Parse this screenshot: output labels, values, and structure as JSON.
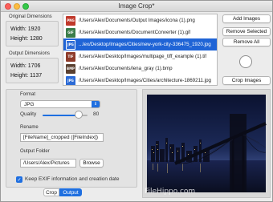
{
  "window": {
    "title": "Image Crop*"
  },
  "original": {
    "label": "Original Dimensions",
    "width": "Width: 1920",
    "height": "Height: 1280"
  },
  "output": {
    "label": "Output Dimensions",
    "width": "Width: 1706",
    "height": "Height: 1137"
  },
  "files": [
    {
      "type": "PNG",
      "color": "#c0392b",
      "name": "/Users/Alex/Documents/Output Images/icona (1).png"
    },
    {
      "type": "GIF",
      "color": "#3b7d4a",
      "name": "/Users/Alex/Documents/DocumentConverter (1).gif"
    },
    {
      "type": "JPG",
      "color": "#2c6bd6",
      "name": "...lex/Desktop/Images/Cities/new-york-city-336475_1920.jpg",
      "selected": true
    },
    {
      "type": "TIF",
      "color": "#8e3b2a",
      "name": "/Users/Alex/Desktop/Images/multipage_tiff_example (1).tif"
    },
    {
      "type": "BMP",
      "color": "#5a4030",
      "name": "/Users/Alex/Documents/lena_gray (1).bmp"
    },
    {
      "type": "JPG",
      "color": "#2c6bd6",
      "name": "/Users/Alex/Desktop/Images/Cities/architecture-1869211.jpg"
    }
  ],
  "buttons": {
    "add": "Add Images",
    "remove_selected": "Remove Selected",
    "remove_all": "Remove All",
    "crop": "Crop Images",
    "browse": "Browse"
  },
  "format": {
    "label": "Format",
    "value": "JPG",
    "quality_label": "Quality",
    "quality_value": "80",
    "quality_fraction": 0.8
  },
  "rename": {
    "label": "Rename",
    "value": "[FileName]_cropped ([FileIndex])"
  },
  "output_folder": {
    "label": "Output Folder",
    "value": "/Users/Alex/Pictures"
  },
  "exif": {
    "label": "Keep EXIF information and creation date",
    "checked": true
  },
  "tabs": {
    "crop": "Crop",
    "output": "Output",
    "active": "output"
  },
  "watermark": "FileHippo.com",
  "colors": {
    "accent": "#1f6fe0",
    "selection": "#1f64d6"
  }
}
